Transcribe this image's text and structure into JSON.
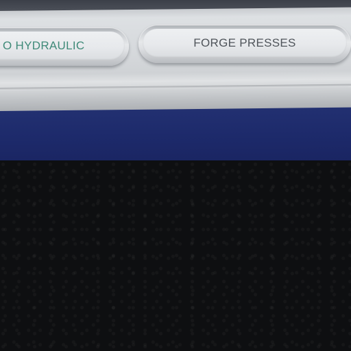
{
  "toolbar": {
    "buttons": [
      {
        "label": "O HYDRAULIC"
      },
      {
        "label": "FORGE PRESSES"
      }
    ]
  },
  "colors": {
    "active_label": "#3f8a78",
    "inactive_label": "#4f545a",
    "banner_blue": "#1d2a6b",
    "panel_silver": "#d6d9dc",
    "background_dark": "#0e0f11"
  }
}
